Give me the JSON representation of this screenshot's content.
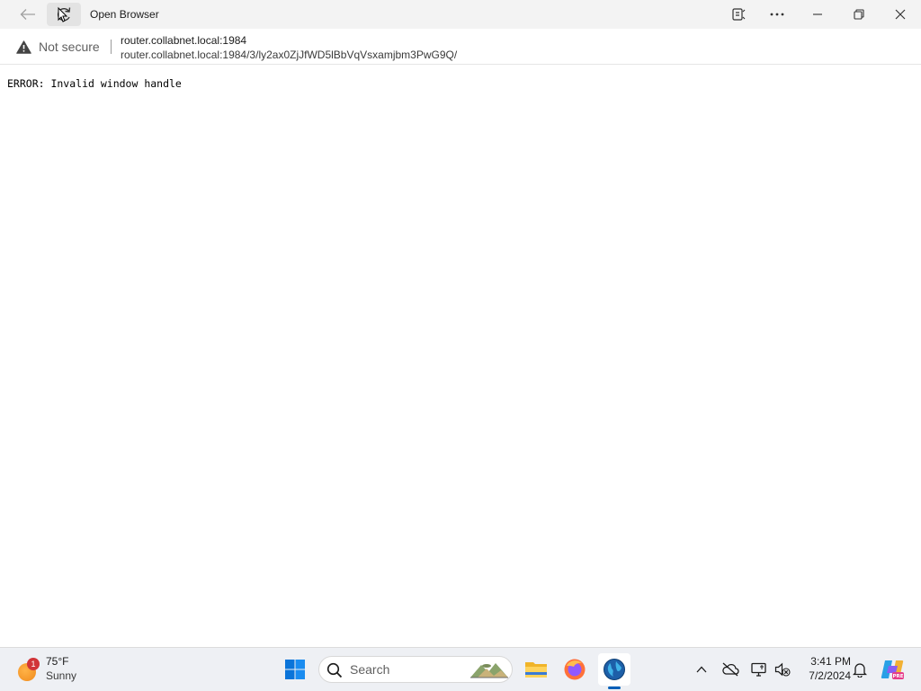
{
  "titlebar": {
    "title": "Open Browser",
    "icons": {
      "back": "arrow-left-icon",
      "refresh": "refresh-icon",
      "read_aloud": "read-aloud-icon",
      "more": "more-icon",
      "minimize": "minimize-icon",
      "maximize": "restore-icon",
      "close": "close-icon"
    }
  },
  "addressbar": {
    "security_label": "Not secure",
    "host": "router.collabnet.local:1984",
    "url": "router.collabnet.local:1984/3/ly2ax0ZjJfWD5lBbVqVsxamjbm3PwG9Q/"
  },
  "page": {
    "error_message": "ERROR: Invalid window handle"
  },
  "taskbar": {
    "weather": {
      "badge": "1",
      "temperature": "75°F",
      "condition": "Sunny"
    },
    "search": {
      "label": "Search"
    },
    "clock": {
      "time": "3:41 PM",
      "date": "7/2/2024"
    }
  },
  "colors": {
    "titlebar_bg": "#f3f3f3",
    "taskbar_bg": "#eef0f4",
    "warning": "#5f5f5f",
    "accent": "#005fb8",
    "badge": "#d13438"
  }
}
